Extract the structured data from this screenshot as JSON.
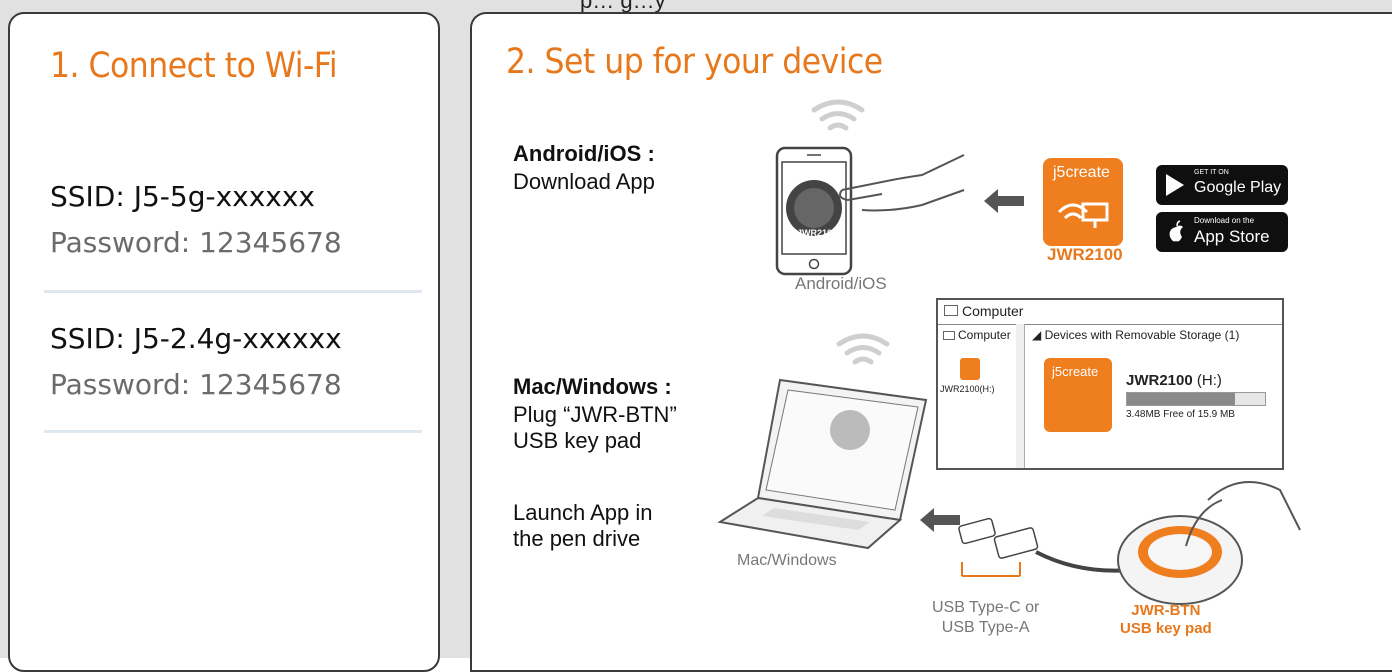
{
  "top_partial_text": "p… g…y",
  "panel1": {
    "title": "1. Connect to Wi-Fi",
    "networks": [
      {
        "ssid": "SSID: J5-5g-xxxxxx",
        "password": "Password: 12345678"
      },
      {
        "ssid": "SSID: J5-2.4g-xxxxxx",
        "password": "Password: 12345678"
      }
    ]
  },
  "panel2": {
    "title": "2. Set up for your device",
    "mobile": {
      "heading": "Android/iOS :",
      "instruction": "Download App",
      "phone_caption": "Android/iOS",
      "phone_app_label": "JWR2100",
      "app_brand": "j5create",
      "app_name": "JWR2100",
      "google_play_small": "GET IT ON",
      "google_play_label": "Google Play",
      "app_store_small": "Download on the",
      "app_store_label": "App Store"
    },
    "desktop": {
      "heading": "Mac/Windows :",
      "instruction_lines": [
        "Plug “JWR-BTN”",
        "USB key pad"
      ],
      "launch_lines": [
        "Launch App in",
        "the pen drive"
      ],
      "laptop_caption": "Mac/Windows",
      "usb_caption_lines": [
        "USB Type-C or",
        "USB Type-A"
      ],
      "keypad_caption_lines": [
        "JWR-BTN",
        "USB key pad"
      ]
    },
    "explorer": {
      "title": "Computer",
      "sidebar_item": "Computer",
      "sidebar_drive": "JWR2100(H:)",
      "section_header": "Devices with Removable Storage (1)",
      "drive_name": "JWR2100",
      "drive_letter": "(H:)",
      "drive_free": "3.48MB Free of 15.9 MB",
      "drive_used_fraction": 0.78,
      "brand": "j5create"
    }
  },
  "colors": {
    "accent": "#e7781c",
    "panel_border": "#3a3a3a",
    "background": "#e1e1e1"
  }
}
